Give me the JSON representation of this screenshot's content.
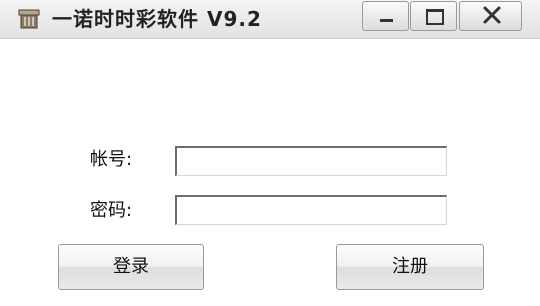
{
  "window": {
    "title": "一诺时时彩软件 V9.2",
    "icon": "app-icon"
  },
  "titlebar_buttons": {
    "minimize_icon": "minimize-icon",
    "maximize_icon": "maximize-icon",
    "close_icon": "close-icon"
  },
  "form": {
    "account_label": "帐号:",
    "account_value": "",
    "password_label": "密码:",
    "password_value": ""
  },
  "buttons": {
    "login_label": "登录",
    "register_label": "注册"
  }
}
